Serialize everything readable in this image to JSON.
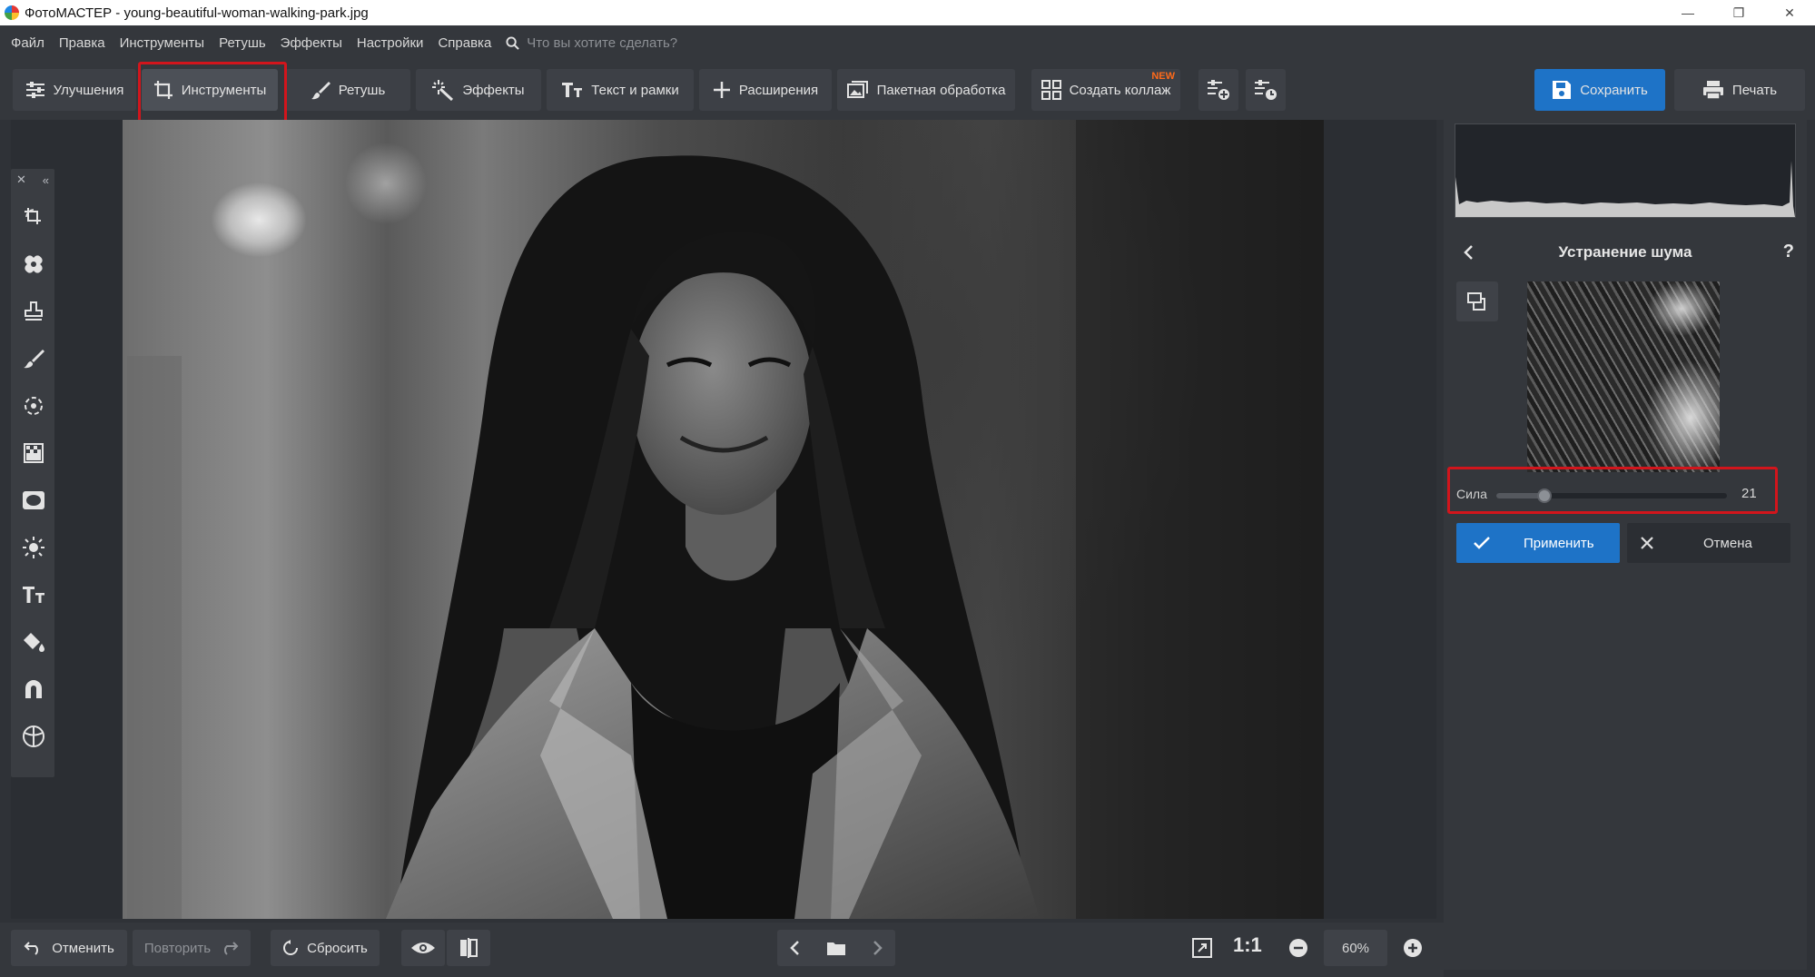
{
  "window": {
    "title": "ФотоМАСТЕР - young-beautiful-woman-walking-park.jpg",
    "controls": [
      "minimize-icon",
      "restore-icon",
      "close-icon"
    ]
  },
  "menu": {
    "items": [
      "Файл",
      "Правка",
      "Инструменты",
      "Ретушь",
      "Эффекты",
      "Настройки",
      "Справка"
    ],
    "search_placeholder": "Что вы хотите сделать?"
  },
  "toolbar": {
    "tabs": [
      {
        "label": "Улучшения",
        "icon": "sliders-icon"
      },
      {
        "label": "Инструменты",
        "icon": "crop-icon",
        "active": true,
        "highlighted": true
      },
      {
        "label": "Ретушь",
        "icon": "brush-icon"
      },
      {
        "label": "Эффекты",
        "icon": "magic-wand-icon"
      },
      {
        "label": "Текст и рамки",
        "icon": "text-icon"
      },
      {
        "label": "Расширения",
        "icon": "plus-icon"
      },
      {
        "label": "Пакетная обработка",
        "icon": "batch-icon"
      },
      {
        "label": "Создать коллаж",
        "icon": "collage-icon",
        "badge": "NEW"
      }
    ],
    "save_label": "Сохранить",
    "print_label": "Печать",
    "badge_color": "#ff6a1a",
    "accent_color": "#1e73c7",
    "highlight_color": "#d2151c"
  },
  "left_tools": [
    "crop-rotate-icon",
    "healing-patch-icon",
    "stamp-icon",
    "brush-icon",
    "radial-icon",
    "gradient-filter-icon",
    "vignette-icon",
    "light-icon",
    "text-tool-icon",
    "fill-icon",
    "magnet-icon",
    "sphere-icon"
  ],
  "right_panel": {
    "title": "Устранение шума",
    "help": "?",
    "slider": {
      "label": "Сила",
      "value": "21",
      "min": 0,
      "max": 100,
      "fraction": 0.21
    },
    "apply_label": "Применить",
    "cancel_label": "Отмена"
  },
  "bottom": {
    "undo_label": "Отменить",
    "redo_label": "Повторить",
    "reset_label": "Сбросить",
    "ratio_label": "1:1",
    "zoom": "60%"
  }
}
